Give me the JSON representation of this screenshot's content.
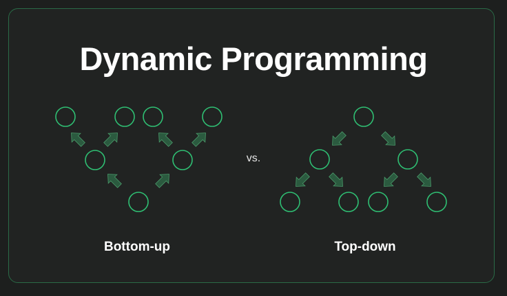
{
  "title": "Dynamic Programming",
  "separator": "vs.",
  "diagrams": {
    "left": {
      "label": "Bottom-up",
      "arrow_direction": "upward (child to parent)"
    },
    "right": {
      "label": "Top-down",
      "arrow_direction": "downward (parent to child)"
    }
  },
  "colors": {
    "background": "#1d1f1e",
    "card": "#212322",
    "card_border": "#2a6b47",
    "node_stroke": "#2fbf73",
    "arrow_fill": "#2b5a3f",
    "arrow_stroke": "#4a9a6a",
    "text": "#ffffff"
  }
}
